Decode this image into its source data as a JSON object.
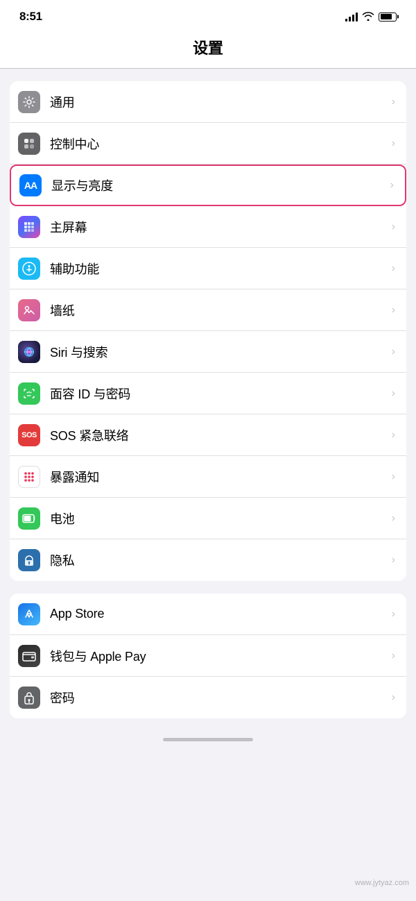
{
  "statusBar": {
    "time": "8:51"
  },
  "pageTitle": "设置",
  "section1": {
    "items": [
      {
        "id": "general",
        "label": "通用",
        "iconClass": "icon-gray",
        "iconContent": "⚙",
        "highlighted": false
      },
      {
        "id": "control-center",
        "label": "控制中心",
        "iconClass": "icon-gray2",
        "iconContent": "⊞",
        "highlighted": false
      },
      {
        "id": "display",
        "label": "显示与亮度",
        "iconClass": "icon-blue",
        "iconContent": "AA",
        "highlighted": true
      },
      {
        "id": "home-screen",
        "label": "主屏幕",
        "iconClass": "icon-colorful",
        "iconContent": "⊞",
        "highlighted": false
      },
      {
        "id": "accessibility",
        "label": "辅助功能",
        "iconClass": "icon-teal",
        "iconContent": "⑧",
        "highlighted": false
      },
      {
        "id": "wallpaper",
        "label": "墙纸",
        "iconClass": "icon-pink",
        "iconContent": "✿",
        "highlighted": false
      },
      {
        "id": "siri",
        "label": "Siri 与搜索",
        "iconClass": "icon-siri",
        "iconContent": "◉",
        "highlighted": false
      },
      {
        "id": "faceid",
        "label": "面容 ID 与密码",
        "iconClass": "icon-green-face",
        "iconContent": "☺",
        "highlighted": false
      },
      {
        "id": "sos",
        "label": "SOS 紧急联络",
        "iconClass": "icon-red",
        "iconContent": "SOS",
        "highlighted": false
      },
      {
        "id": "exposure",
        "label": "暴露通知",
        "iconClass": "icon-exposure",
        "iconContent": "dots",
        "highlighted": false
      },
      {
        "id": "battery",
        "label": "电池",
        "iconClass": "icon-battery-green",
        "iconContent": "🔋",
        "highlighted": false
      },
      {
        "id": "privacy",
        "label": "隐私",
        "iconClass": "icon-privacy",
        "iconContent": "✋",
        "highlighted": false
      }
    ]
  },
  "section2": {
    "items": [
      {
        "id": "appstore",
        "label": "App Store",
        "iconClass": "icon-appstore",
        "iconContent": "A",
        "highlighted": false
      },
      {
        "id": "wallet",
        "label": "钱包与 Apple Pay",
        "iconClass": "icon-wallet",
        "iconContent": "▤",
        "highlighted": false
      },
      {
        "id": "password",
        "label": "密码",
        "iconClass": "icon-password",
        "iconContent": "🔑",
        "highlighted": false
      }
    ]
  }
}
